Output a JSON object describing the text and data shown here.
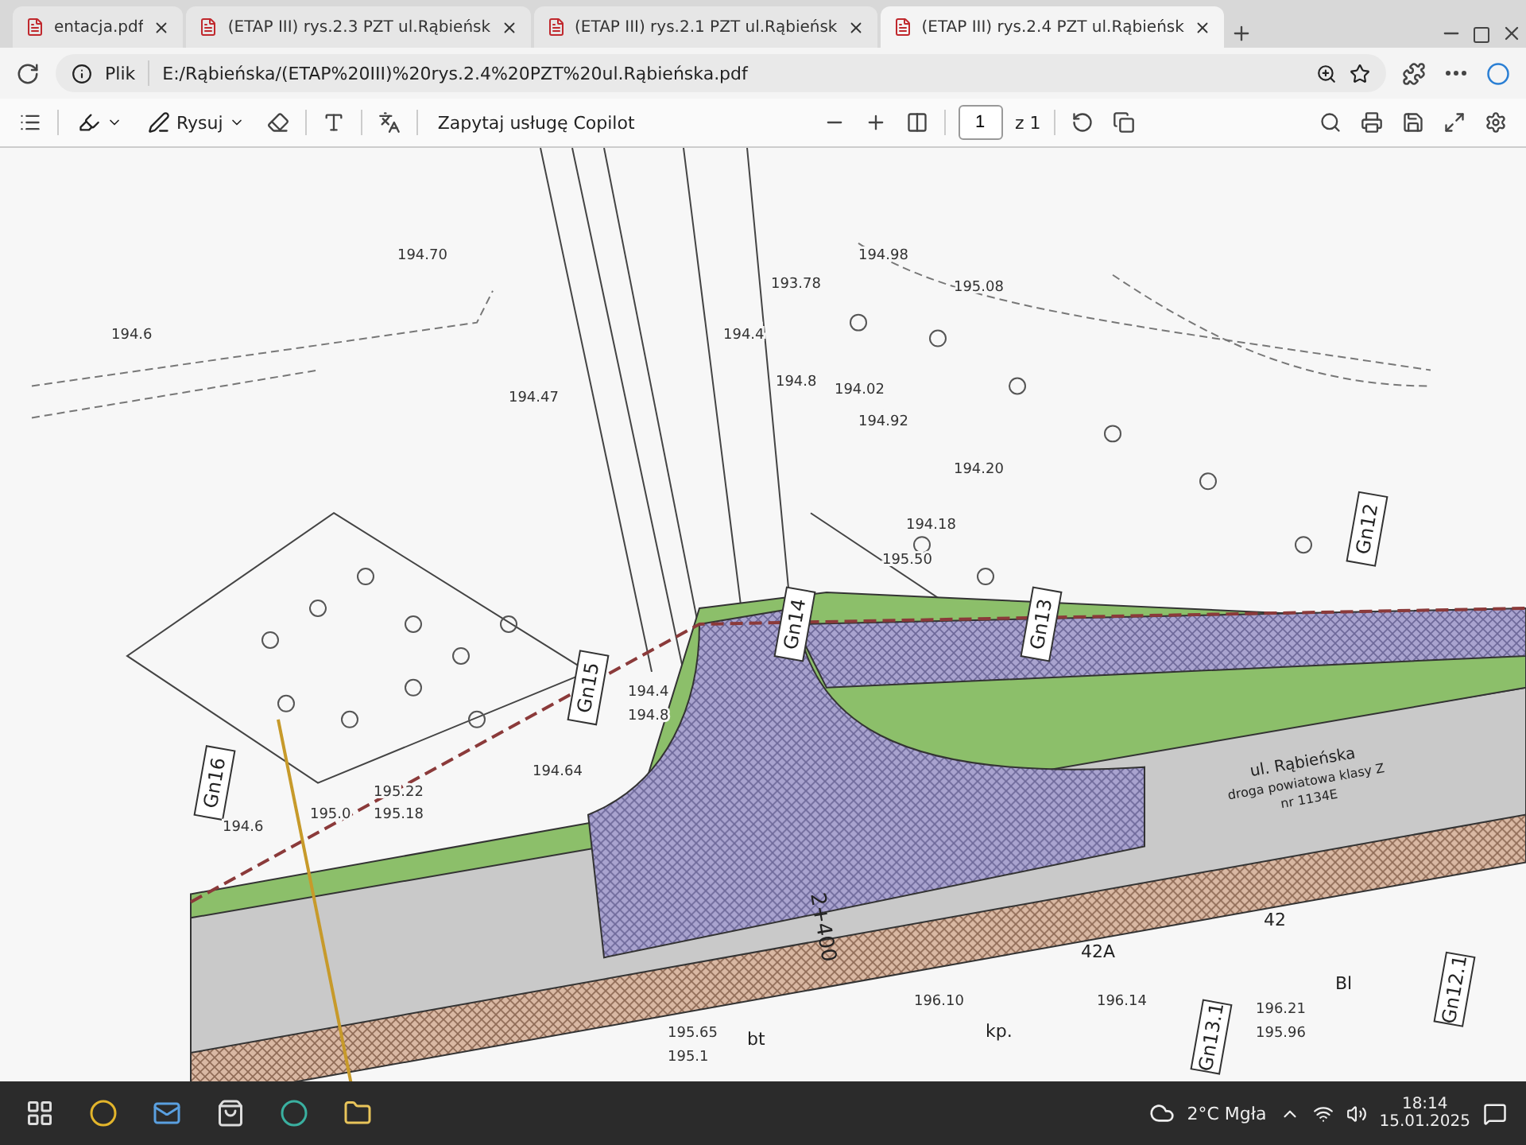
{
  "tabs": [
    {
      "title": "entacja.pdf",
      "selected": false
    },
    {
      "title": "(ETAP III) rys.2.3 PZT ul.Rąbieńsk",
      "selected": false
    },
    {
      "title": "(ETAP III) rys.2.1 PZT ul.Rąbieńsk",
      "selected": false
    },
    {
      "title": "(ETAP III) rys.2.4 PZT ul.Rąbieńsk",
      "selected": true
    }
  ],
  "address_bar": {
    "scheme_label": "Plik",
    "url": "E:/Rąbieńska/(ETAP%20III)%20rys.2.4%20PZT%20ul.Rąbieńska.pdf"
  },
  "pdf_toolbar": {
    "draw_label": "Rysuj",
    "copilot_label": "Zapytaj usługę Copilot",
    "page": "1",
    "page_total": "z 1"
  },
  "drawing": {
    "stations": [
      "Gn16",
      "Gn15",
      "Gn14",
      "Gn13",
      "Gn12",
      "Gn13.1",
      "Gn12.1"
    ],
    "elevations": [
      "194.70",
      "194.6",
      "194.98",
      "195.08",
      "193.78",
      "194.47",
      "194.4",
      "194.8",
      "194.02",
      "194.92",
      "194.20",
      "194.18",
      "195.50",
      "194.4",
      "194.8",
      "194.64",
      "195.22",
      "195.18",
      "195.0",
      "194.6",
      "196.10",
      "196.14",
      "196.21",
      "195.96",
      "195.65",
      "195.1"
    ],
    "street_name": "ul. Rąbieńska",
    "road_class": "droga powiatowa klasy Z",
    "road_number": "nr 1134E",
    "chainage": "2+400",
    "lot_labels": [
      "42A",
      "42",
      "Bl",
      "kp.",
      "bt"
    ]
  },
  "taskbar": {
    "weather": "2°C Mgła",
    "time": "18:14",
    "date": "15.01.2025"
  }
}
